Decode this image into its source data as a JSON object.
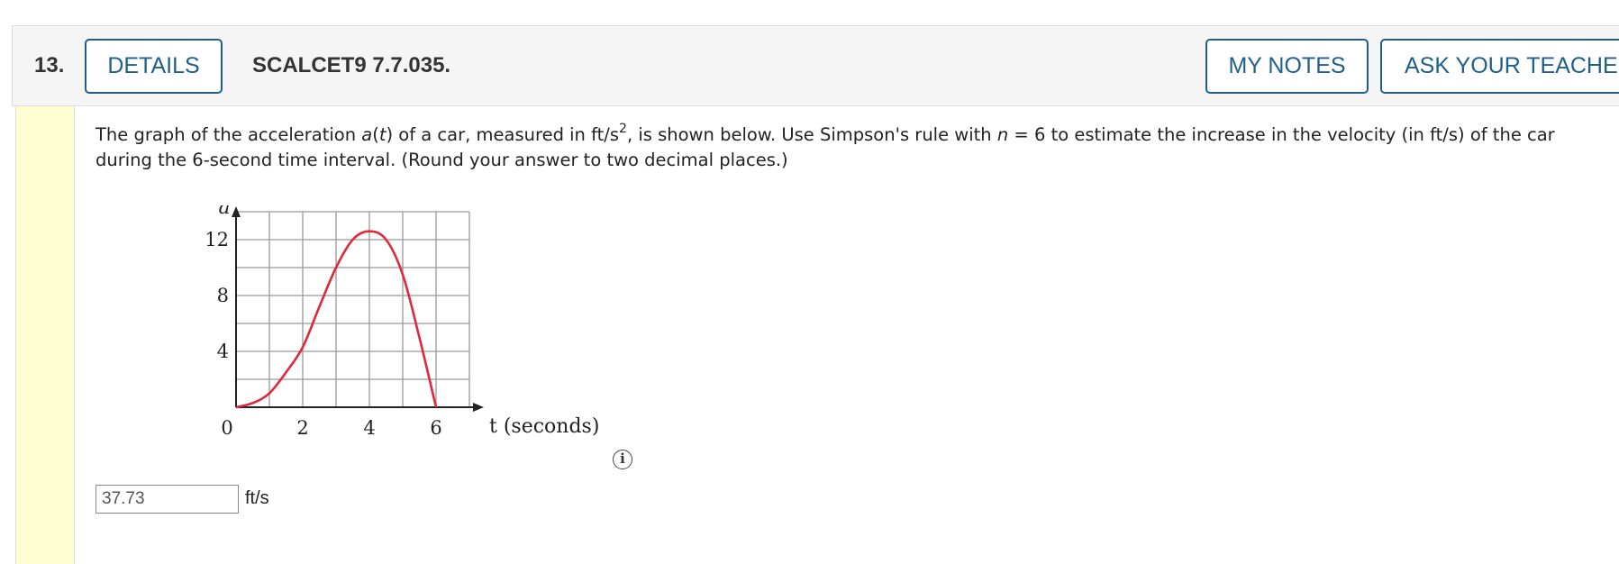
{
  "header": {
    "number": "13.",
    "details_label": "DETAILS",
    "code": "SCALCET9 7.7.035.",
    "notes_label": "MY NOTES",
    "teacher_label": "ASK YOUR TEACHER"
  },
  "question": {
    "part1": "The graph of the acceleration ",
    "a": "a",
    "open": "(",
    "t": "t",
    "close": ")",
    "part2": " of a car, measured in ft/s",
    "sup": "2",
    "part3": ", is shown below. Use Simpson's rule with ",
    "n": "n",
    "part4": " = 6 to estimate the increase in the velocity (in ft/s) of the car during the 6-second time interval. (Round your answer to two decimal places.)"
  },
  "chart_data": {
    "type": "line",
    "xlabel": "t (seconds)",
    "ylabel": "a",
    "xlim": [
      0,
      7
    ],
    "ylim": [
      0,
      14
    ],
    "x_ticks": [
      "0",
      "2",
      "4",
      "6"
    ],
    "y_ticks": [
      "4",
      "8",
      "12"
    ],
    "grid": true,
    "series": [
      {
        "x": [
          0,
          0.5,
          1,
          1.5,
          2,
          2.5,
          3,
          3.5,
          4,
          4.5,
          5,
          5.5,
          6
        ],
        "y": [
          0,
          0.3,
          1,
          2.5,
          4.3,
          7.2,
          10,
          12,
          12.6,
          12,
          9.5,
          5,
          0
        ]
      }
    ],
    "line_color": "#e0283c"
  },
  "answer": {
    "value": "37.73",
    "unit": "ft/s"
  },
  "info_icon": "i"
}
